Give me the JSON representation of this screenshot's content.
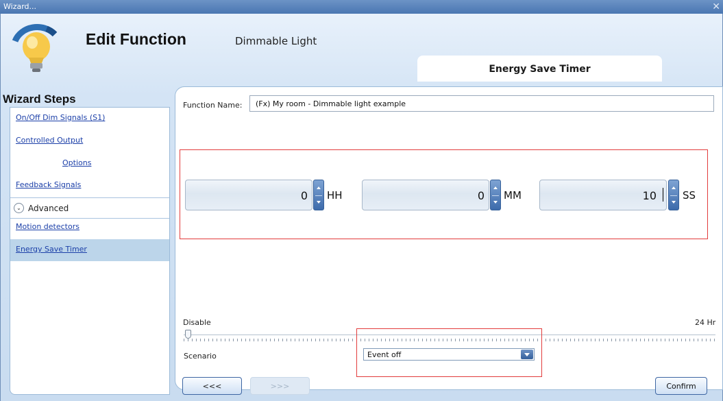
{
  "window": {
    "title": "Wizard...",
    "close_glyph": "✕"
  },
  "header": {
    "title": "Edit Function",
    "subtitle": "Dimmable Light",
    "active_tab": "Energy Save Timer",
    "icon": "light-bulb-icon"
  },
  "sidebar": {
    "title": "Wizard Steps",
    "items": [
      {
        "label": "On/Off Dim Signals (S1)"
      },
      {
        "label": "Controlled Output"
      },
      {
        "label": "Options"
      },
      {
        "label": "Feedback Signals"
      },
      {
        "label": "Motion detectors"
      },
      {
        "label": "Energy Save Timer",
        "selected": true
      }
    ],
    "advanced": {
      "label": "Advanced",
      "icon": "chevron-down-icon"
    }
  },
  "form": {
    "function_name_label": "Function Name:",
    "function_name_value": "(Fx) My room - Dimmable light example",
    "timer": {
      "hours": {
        "value": "0",
        "unit": "HH"
      },
      "minutes": {
        "value": "0",
        "unit": "MM"
      },
      "seconds": {
        "value": "10",
        "unit": "SS"
      }
    },
    "slider": {
      "min_label": "Disable",
      "max_label": "24 Hr",
      "value_fraction": 0
    },
    "scenario_label": "Scenario",
    "scenario_value": "Event off"
  },
  "buttons": {
    "prev": "<<<",
    "next": ">>>",
    "confirm": "Confirm"
  },
  "colors": {
    "highlight_box": "#e23b3b",
    "selected_step_bg": "#bcd5ea",
    "link": "#1b3fa8"
  }
}
